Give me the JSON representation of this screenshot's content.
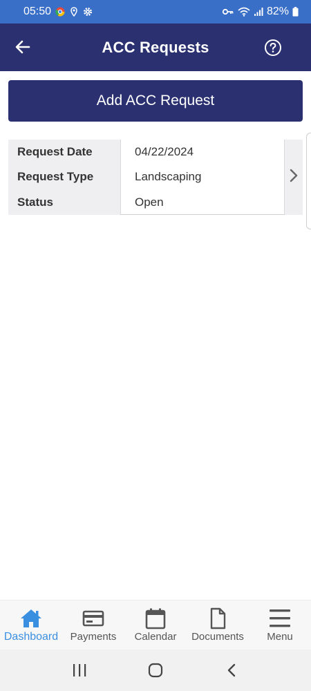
{
  "status_bar": {
    "time": "05:50",
    "battery": "82%"
  },
  "app_bar": {
    "title": "ACC Requests"
  },
  "actions": {
    "add_label": "Add ACC Request"
  },
  "request": {
    "labels": {
      "date": "Request Date",
      "type": "Request Type",
      "status": "Status"
    },
    "values": {
      "date": "04/22/2024",
      "type": "Landscaping",
      "status": "Open"
    }
  },
  "bottom_nav": {
    "items": [
      {
        "label": "Dashboard",
        "icon": "home-icon"
      },
      {
        "label": "Payments",
        "icon": "credit-card-icon"
      },
      {
        "label": "Calendar",
        "icon": "calendar-icon"
      },
      {
        "label": "Documents",
        "icon": "document-icon"
      },
      {
        "label": "Menu",
        "icon": "menu-icon"
      }
    ]
  },
  "colors": {
    "status_bar": "#3a6fc8",
    "primary": "#2b3170",
    "active_nav": "#3b8fe0"
  }
}
